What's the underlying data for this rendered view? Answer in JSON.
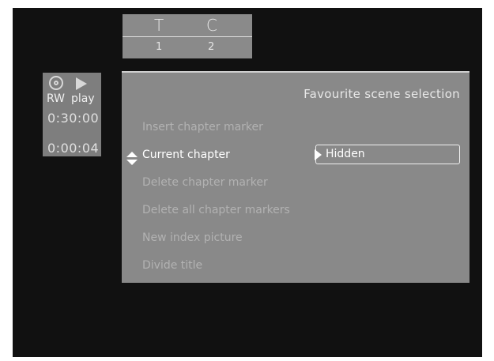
{
  "title_chapter": {
    "headers": [
      "T",
      "C"
    ],
    "values": [
      "1",
      "2"
    ]
  },
  "status": {
    "disc_icon": "disc-icon",
    "play_icon": "play-icon",
    "disc_label": "RW",
    "mode_label": "play",
    "time_total": "0:30:00",
    "time_current": "0:00:04"
  },
  "menu": {
    "header": "Favourite scene selection",
    "items": [
      {
        "label": "Insert chapter marker"
      },
      {
        "label": "Current chapter"
      },
      {
        "label": "Delete chapter marker"
      },
      {
        "label": "Delete all chapter markers"
      },
      {
        "label": "New index picture"
      },
      {
        "label": "Divide title"
      }
    ],
    "current_value": "Hidden"
  }
}
